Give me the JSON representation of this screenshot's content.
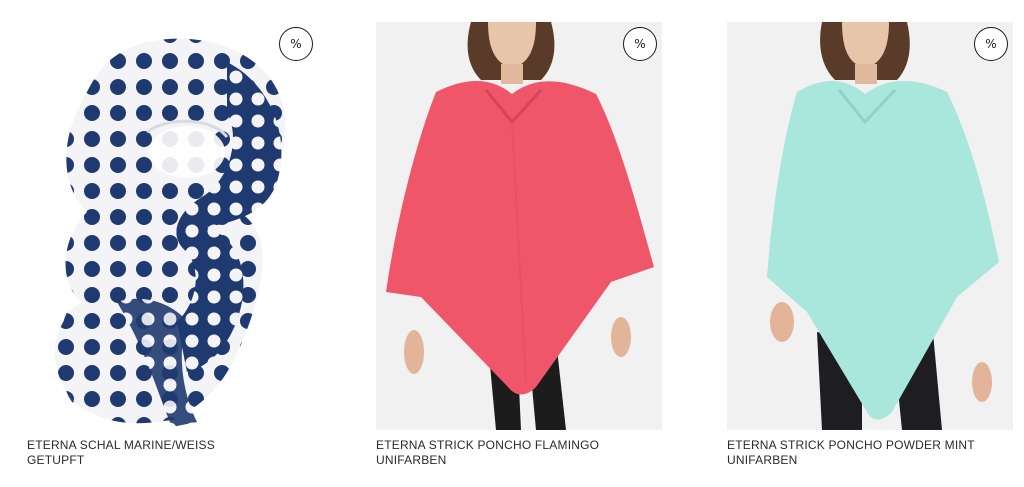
{
  "products": [
    {
      "name_line1": "ETERNA SCHAL MARINE/WEISS",
      "name_line2": "GETUPFT",
      "badge": "%",
      "image_icon": "scarf-product-image",
      "color": "#1f3a70"
    },
    {
      "name_line1": "ETERNA STRICK PONCHO FLAMINGO",
      "name_line2": "UNIFARBEN",
      "badge": "%",
      "image_icon": "poncho-product-image",
      "color": "#f0566a"
    },
    {
      "name_line1": "ETERNA STRICK PONCHO POWDER MINT",
      "name_line2": "UNIFARBEN",
      "badge": "%",
      "image_icon": "poncho-product-image",
      "color": "#a9e6dc"
    }
  ]
}
